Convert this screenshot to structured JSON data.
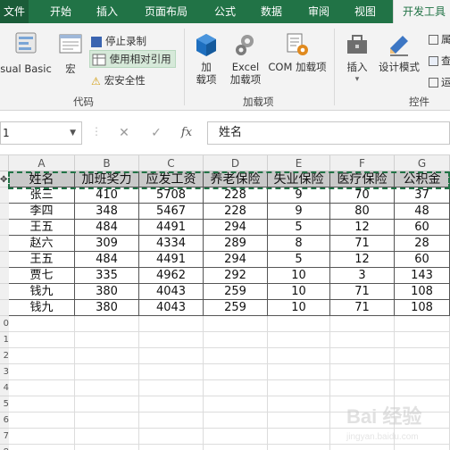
{
  "tabs": {
    "file": "文件",
    "items": [
      "开始",
      "插入",
      "页面布局",
      "公式",
      "数据",
      "审阅",
      "视图"
    ],
    "active": "开发工具"
  },
  "ribbon": {
    "code_group": {
      "visual_basic": "sual Basic",
      "macros": "宏",
      "stop_recording": "停止录制",
      "relative_refs": "使用相对引用",
      "macro_security": "宏安全性",
      "label": "代码"
    },
    "addins_group": {
      "addins_line1": "加",
      "addins_line2": "载项",
      "excel_addins_line1": "Excel",
      "excel_addins_line2": "加载项",
      "com_addins": "COM 加载项",
      "label": "加载项"
    },
    "controls_group": {
      "insert": "插入",
      "design_mode": "设计模式",
      "properties": "属",
      "view_code": "查",
      "run_dialog": "运",
      "label": "控件"
    }
  },
  "formula_bar": {
    "name_box": "1",
    "fx": "fx",
    "formula": "姓名"
  },
  "sheet": {
    "columns": [
      "A",
      "B",
      "C",
      "D",
      "E",
      "F",
      "G"
    ],
    "row_numbers": [
      "",
      "",
      "",
      "",
      "",
      "",
      "",
      "",
      "",
      "",
      "",
      "",
      "",
      "",
      "",
      "",
      "",
      ""
    ],
    "header": [
      "姓名",
      "加班奖力",
      "应发工资",
      "养老保险",
      "失业保险",
      "医疗保险",
      "公积金"
    ],
    "rows": [
      [
        "张三",
        "410",
        "5708",
        "228",
        "9",
        "70",
        "37"
      ],
      [
        "李四",
        "348",
        "5467",
        "228",
        "9",
        "80",
        "48"
      ],
      [
        "王五",
        "484",
        "4491",
        "294",
        "5",
        "12",
        "60"
      ],
      [
        "赵六",
        "309",
        "4334",
        "289",
        "8",
        "71",
        "28"
      ],
      [
        "王五",
        "484",
        "4491",
        "294",
        "5",
        "12",
        "60"
      ],
      [
        "贾七",
        "335",
        "4962",
        "292",
        "10",
        "3",
        "143"
      ],
      [
        "钱九",
        "380",
        "4043",
        "259",
        "10",
        "71",
        "108"
      ],
      [
        "钱九",
        "380",
        "4043",
        "259",
        "10",
        "71",
        "108"
      ]
    ],
    "empty_row_labels": [
      "0",
      "1",
      "2",
      "3",
      "4",
      "5",
      "6",
      "7",
      "8"
    ]
  },
  "watermark": "Bai 经验"
}
